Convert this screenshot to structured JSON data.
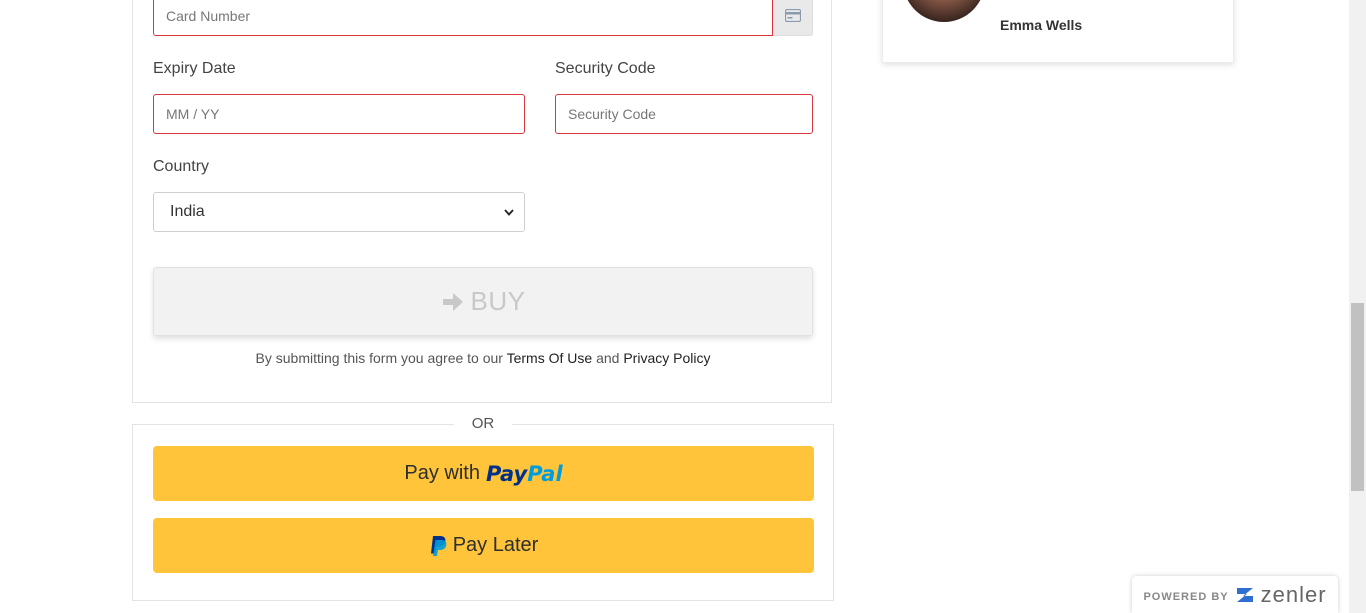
{
  "checkout": {
    "card_number_placeholder": "Card Number",
    "expiry_label": "Expiry Date",
    "expiry_placeholder": "MM / YY",
    "security_label": "Security Code",
    "security_placeholder": "Security Code",
    "country_label": "Country",
    "country_value": "India",
    "buy_label": "BUY",
    "terms_prefix": "By submitting this form you agree to our ",
    "terms_link": "Terms Of Use",
    "terms_and": " and ",
    "privacy_link": "Privacy Policy"
  },
  "divider": {
    "or": "OR"
  },
  "paypal": {
    "pay_with": "Pay with",
    "logo_pay": "Pay",
    "logo_pal": "Pal",
    "pay_later": "Pay Later"
  },
  "instructor": {
    "name": "Emma Wells"
  },
  "badge": {
    "powered_by": "POWERED BY",
    "brand": "zenler"
  },
  "colors": {
    "error_border": "#d9363e",
    "paypal_yellow": "#ffc439",
    "paypal_dark": "#003087",
    "paypal_light": "#009cde"
  },
  "icons": {
    "card_addon": "credit-card-icon",
    "buy": "arrow-right-icon",
    "select": "chevron-down-icon",
    "paypal": "paypal-p-icon"
  }
}
